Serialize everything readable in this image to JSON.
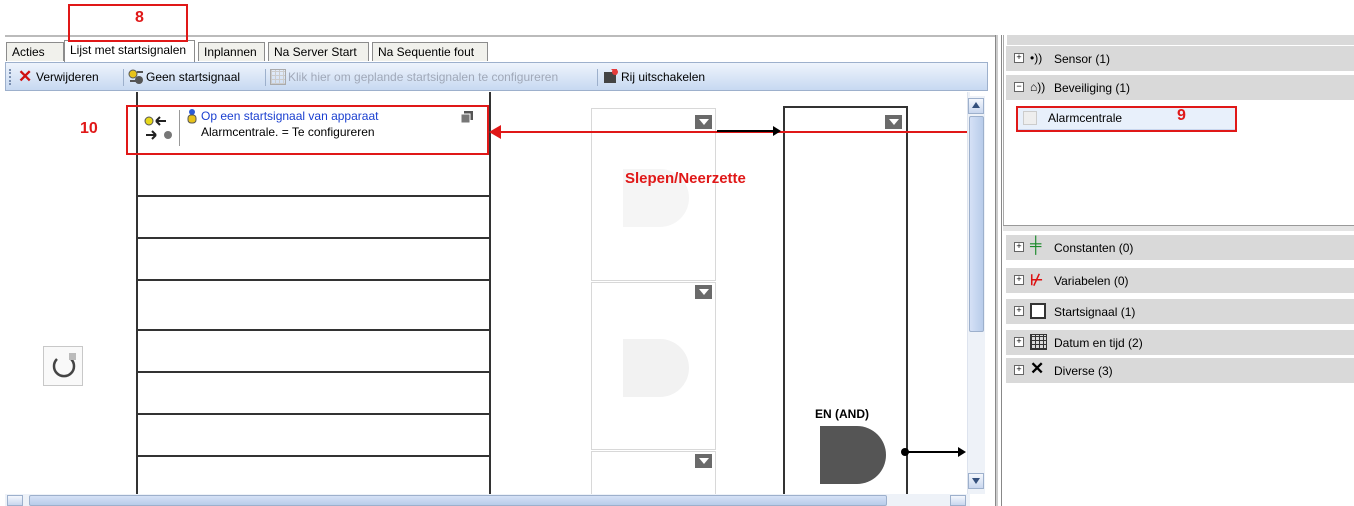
{
  "annotations": {
    "tab_callout": "8",
    "alarm_callout": "9",
    "trigger_callout": "10",
    "drag_drop_label": "Slepen/Neerzette"
  },
  "tabs": [
    {
      "label": "Acties"
    },
    {
      "label": "Lijst met startsignalen"
    },
    {
      "label": "Inplannen"
    },
    {
      "label": "Na Server Start"
    },
    {
      "label": "Na Sequentie fout"
    }
  ],
  "toolbar": {
    "delete_label": "Verwijderen",
    "no_trigger_label": "Geen startsignaal",
    "configure_label": "Klik hier om geplande startsignalen te configureren",
    "disable_row_label": "Rij uitschakelen"
  },
  "trigger_block": {
    "title": "Op een startsignaal van apparaat",
    "subtitle": "Alarmcentrale. = Te configureren"
  },
  "gate_label": "EN (AND)",
  "right_top_tree": [
    {
      "label": "Sensor (1)",
      "icon": "sensor-icon",
      "expanded": false
    },
    {
      "label": "Beveiliging (1)",
      "icon": "security-icon",
      "expanded": true
    },
    {
      "label": "Alarmcentrale",
      "icon": "device-icon",
      "selected": true
    }
  ],
  "right_bottom_tree": [
    {
      "label": "Constanten (0)",
      "icon": "constants-icon"
    },
    {
      "label": "Variabelen (0)",
      "icon": "variables-icon"
    },
    {
      "label": "Startsignaal (1)",
      "icon": "trigger-icon"
    },
    {
      "label": "Datum en tijd (2)",
      "icon": "calendar-icon"
    },
    {
      "label": "Diverse (3)",
      "icon": "tools-icon"
    }
  ],
  "colors": {
    "annotation_red": "#e01818",
    "link_blue": "#1a3fd0",
    "toolbar_blue": "#c7d9f1",
    "selected_row": "#e8f0fb"
  }
}
